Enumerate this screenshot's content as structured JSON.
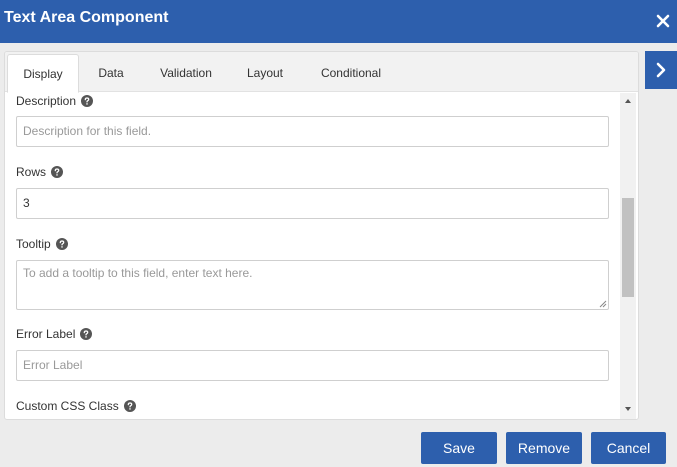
{
  "dialog": {
    "title": "Text Area Component"
  },
  "tabs": [
    {
      "label": "Display"
    },
    {
      "label": "Data"
    },
    {
      "label": "Validation"
    },
    {
      "label": "Layout"
    },
    {
      "label": "Conditional"
    }
  ],
  "fields": {
    "description": {
      "label": "Description",
      "placeholder": "Description for this field."
    },
    "rows": {
      "label": "Rows",
      "value": "3"
    },
    "tooltip": {
      "label": "Tooltip",
      "placeholder": "To add a tooltip to this field, enter text here."
    },
    "error_label": {
      "label": "Error Label",
      "placeholder": "Error Label"
    },
    "custom_css": {
      "label": "Custom CSS Class"
    }
  },
  "buttons": {
    "save": "Save",
    "remove": "Remove",
    "cancel": "Cancel"
  },
  "icons": {
    "close": "close-icon",
    "help": "question-circle-icon",
    "side_toggle": "chevron-right-icon"
  },
  "colors": {
    "primary": "#2d5fad",
    "background": "#ececec"
  }
}
